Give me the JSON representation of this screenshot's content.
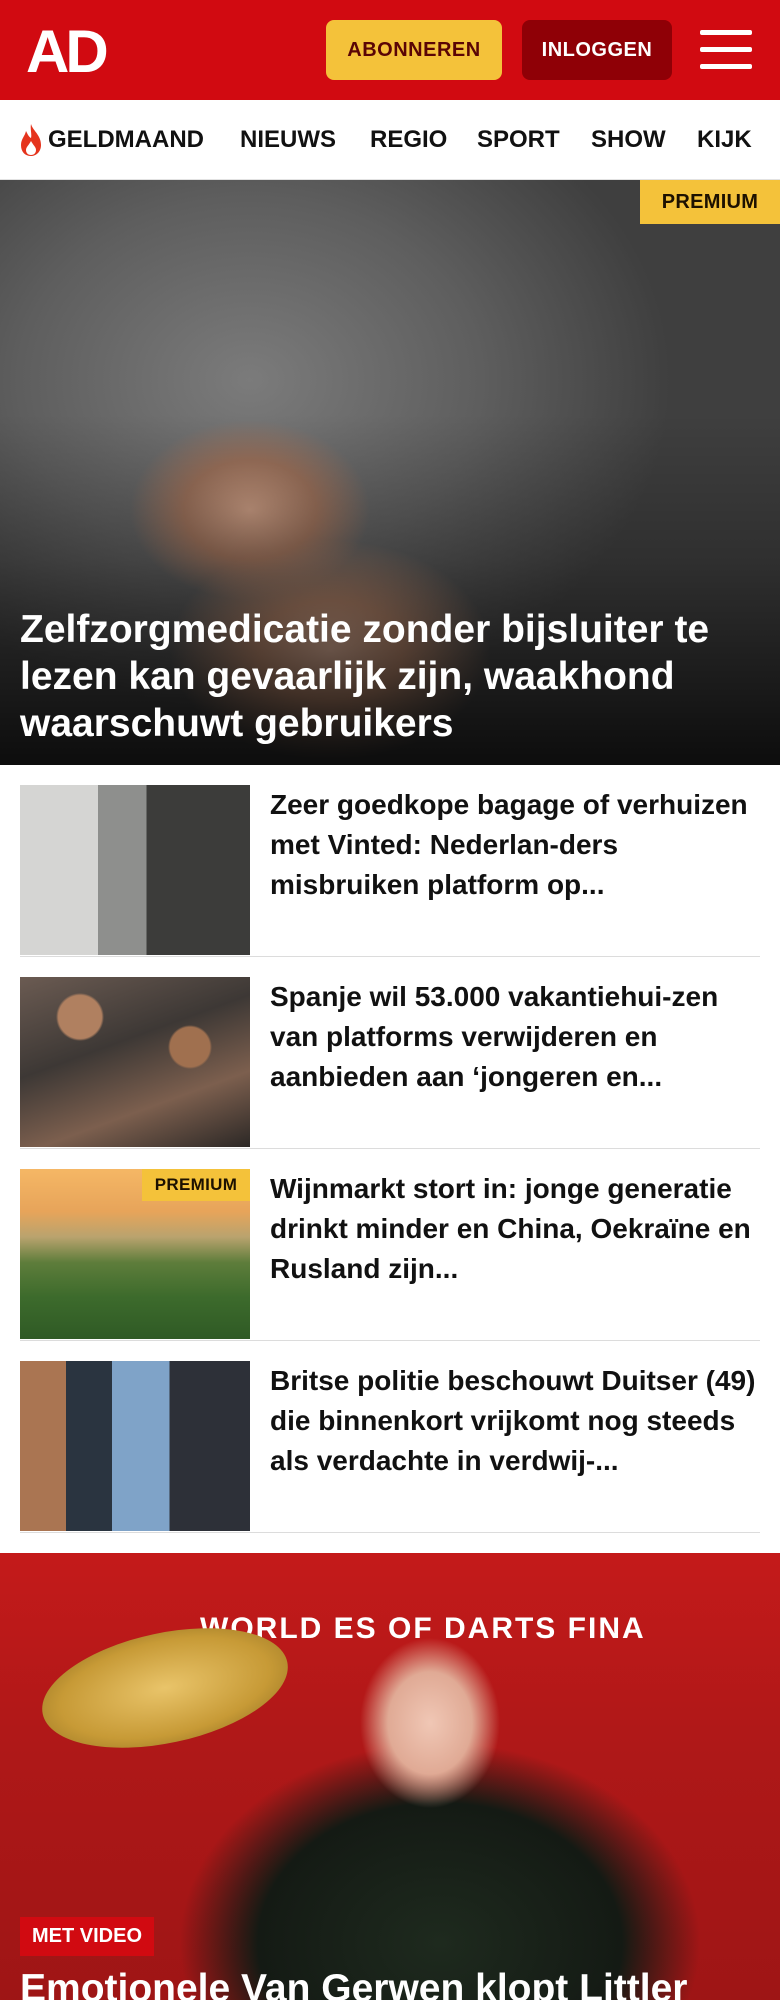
{
  "header": {
    "logo_text": "AD",
    "subscribe_label": "ABONNEREN",
    "login_label": "INLOGGEN",
    "menu_icon": "hamburger-icon",
    "brand_color": "#d10a11"
  },
  "nav": {
    "items": [
      {
        "label": "GELDMAAND",
        "icon": "flame-icon"
      },
      {
        "label": "NIEUWS"
      },
      {
        "label": "REGIO"
      },
      {
        "label": "SPORT"
      },
      {
        "label": "SHOW"
      },
      {
        "label": "KIJK"
      }
    ]
  },
  "hero": {
    "badge": "PREMIUM",
    "title": "Zelfzorgmedicatie zonder bijsluiter te lezen kan gevaarlijk zijn, waakhond waarschuwt gebruikers"
  },
  "stories": [
    {
      "title": "Zeer goedkope bagage of verhuizen met Vinted: Nederlan-ders misbruiken platform op..."
    },
    {
      "title": "Spanje wil 53.000 vakantiehui-zen van platforms verwijderen en aanbieden aan ‘jongeren en..."
    },
    {
      "title": "Wijnmarkt stort in: jonge generatie drinkt minder en China, Oekraïne en Rusland zijn...",
      "badge": "PREMIUM"
    },
    {
      "title": "Britse politie beschouwt Duitser (49) die binnenkort vrijkomt nog steeds als verdachte in verdwij-..."
    }
  ],
  "video_story": {
    "badge": "MET VIDEO",
    "banner": "WORLD  ES OF DARTS FINA",
    "title": "Emotionele Van Gerwen klopt Littler"
  }
}
